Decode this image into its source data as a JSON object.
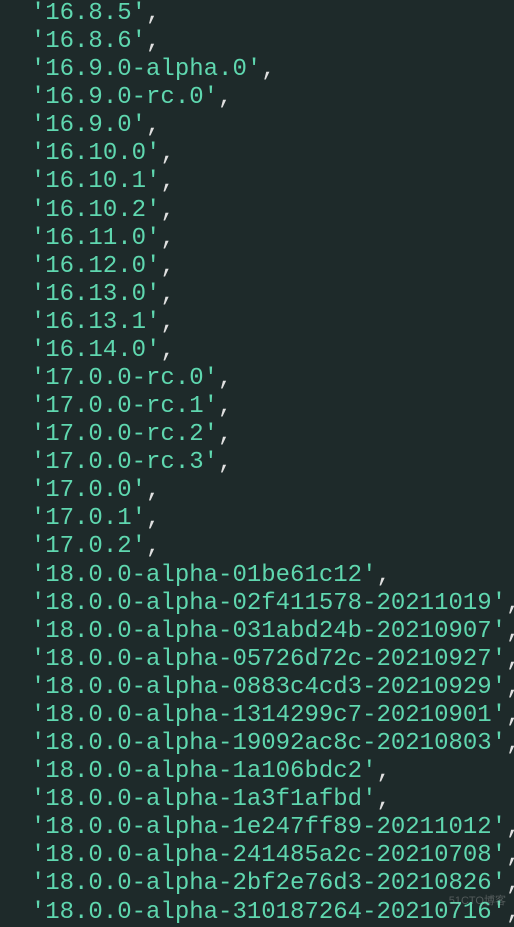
{
  "lines": [
    {
      "indent": "  ",
      "value": "'16.8.5'",
      "comma": ","
    },
    {
      "indent": "  ",
      "value": "'16.8.6'",
      "comma": ","
    },
    {
      "indent": "  ",
      "value": "'16.9.0-alpha.0'",
      "comma": ","
    },
    {
      "indent": "  ",
      "value": "'16.9.0-rc.0'",
      "comma": ","
    },
    {
      "indent": "  ",
      "value": "'16.9.0'",
      "comma": ","
    },
    {
      "indent": "  ",
      "value": "'16.10.0'",
      "comma": ","
    },
    {
      "indent": "  ",
      "value": "'16.10.1'",
      "comma": ","
    },
    {
      "indent": "  ",
      "value": "'16.10.2'",
      "comma": ","
    },
    {
      "indent": "  ",
      "value": "'16.11.0'",
      "comma": ","
    },
    {
      "indent": "  ",
      "value": "'16.12.0'",
      "comma": ","
    },
    {
      "indent": "  ",
      "value": "'16.13.0'",
      "comma": ","
    },
    {
      "indent": "  ",
      "value": "'16.13.1'",
      "comma": ","
    },
    {
      "indent": "  ",
      "value": "'16.14.0'",
      "comma": ","
    },
    {
      "indent": "  ",
      "value": "'17.0.0-rc.0'",
      "comma": ","
    },
    {
      "indent": "  ",
      "value": "'17.0.0-rc.1'",
      "comma": ","
    },
    {
      "indent": "  ",
      "value": "'17.0.0-rc.2'",
      "comma": ","
    },
    {
      "indent": "  ",
      "value": "'17.0.0-rc.3'",
      "comma": ","
    },
    {
      "indent": "  ",
      "value": "'17.0.0'",
      "comma": ","
    },
    {
      "indent": "  ",
      "value": "'17.0.1'",
      "comma": ","
    },
    {
      "indent": "  ",
      "value": "'17.0.2'",
      "comma": ","
    },
    {
      "indent": "  ",
      "value": "'18.0.0-alpha-01be61c12'",
      "comma": ","
    },
    {
      "indent": "  ",
      "value": "'18.0.0-alpha-02f411578-20211019'",
      "comma": ","
    },
    {
      "indent": "  ",
      "value": "'18.0.0-alpha-031abd24b-20210907'",
      "comma": ","
    },
    {
      "indent": "  ",
      "value": "'18.0.0-alpha-05726d72c-20210927'",
      "comma": ","
    },
    {
      "indent": "  ",
      "value": "'18.0.0-alpha-0883c4cd3-20210929'",
      "comma": ","
    },
    {
      "indent": "  ",
      "value": "'18.0.0-alpha-1314299c7-20210901'",
      "comma": ","
    },
    {
      "indent": "  ",
      "value": "'18.0.0-alpha-19092ac8c-20210803'",
      "comma": ","
    },
    {
      "indent": "  ",
      "value": "'18.0.0-alpha-1a106bdc2'",
      "comma": ","
    },
    {
      "indent": "  ",
      "value": "'18.0.0-alpha-1a3f1afbd'",
      "comma": ","
    },
    {
      "indent": "  ",
      "value": "'18.0.0-alpha-1e247ff89-20211012'",
      "comma": ","
    },
    {
      "indent": "  ",
      "value": "'18.0.0-alpha-241485a2c-20210708'",
      "comma": ","
    },
    {
      "indent": "  ",
      "value": "'18.0.0-alpha-2bf2e76d3-20210826'",
      "comma": ","
    },
    {
      "indent": "  ",
      "value": "'18.0.0-alpha-310187264-20210716'",
      "comma": ","
    }
  ],
  "watermark": "51CTO博客"
}
